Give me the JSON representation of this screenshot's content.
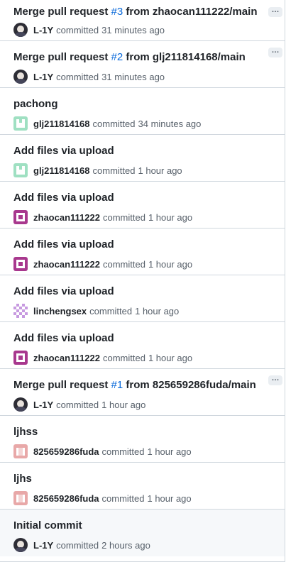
{
  "commits": [
    {
      "title_prefix": "Merge pull request ",
      "pr_link": "#3",
      "title_suffix": " from zhaocan111222/main",
      "author": "L-1Y",
      "verb": "committed",
      "time": "31 minutes ago",
      "avatar": "photo-avatar",
      "has_ellipsis": true
    },
    {
      "title_prefix": "Merge pull request ",
      "pr_link": "#2",
      "title_suffix": " from glj211814168/main",
      "author": "L-1Y",
      "verb": "committed",
      "time": "31 minutes ago",
      "avatar": "photo-avatar",
      "has_ellipsis": true
    },
    {
      "title_prefix": "pachong",
      "pr_link": "",
      "title_suffix": "",
      "author": "glj211814168",
      "verb": "committed",
      "time": "34 minutes ago",
      "avatar": "green-identicon"
    },
    {
      "title_prefix": "Add files via upload",
      "pr_link": "",
      "title_suffix": "",
      "author": "glj211814168",
      "verb": "committed",
      "time": "1 hour ago",
      "avatar": "green-identicon"
    },
    {
      "title_prefix": "Add files via upload",
      "pr_link": "",
      "title_suffix": "",
      "author": "zhaocan111222",
      "verb": "committed",
      "time": "1 hour ago",
      "avatar": "purple-identicon"
    },
    {
      "title_prefix": "Add files via upload",
      "pr_link": "",
      "title_suffix": "",
      "author": "zhaocan111222",
      "verb": "committed",
      "time": "1 hour ago",
      "avatar": "purple-identicon"
    },
    {
      "title_prefix": "Add files via upload",
      "pr_link": "",
      "title_suffix": "",
      "author": "linchengsex",
      "verb": "committed",
      "time": "1 hour ago",
      "avatar": "lilac-identicon"
    },
    {
      "title_prefix": "Add files via upload",
      "pr_link": "",
      "title_suffix": "",
      "author": "zhaocan111222",
      "verb": "committed",
      "time": "1 hour ago",
      "avatar": "purple-identicon"
    },
    {
      "title_prefix": "Merge pull request ",
      "pr_link": "#1",
      "title_suffix": " from 825659286fuda/main",
      "author": "L-1Y",
      "verb": "committed",
      "time": "1 hour ago",
      "avatar": "photo-avatar",
      "has_ellipsis": true
    },
    {
      "title_prefix": "ljhss",
      "pr_link": "",
      "title_suffix": "",
      "author": "825659286fuda",
      "verb": "committed",
      "time": "1 hour ago",
      "avatar": "salmon-identicon"
    },
    {
      "title_prefix": "ljhs",
      "pr_link": "",
      "title_suffix": "",
      "author": "825659286fuda",
      "verb": "committed",
      "time": "1 hour ago",
      "avatar": "salmon-identicon"
    },
    {
      "title_prefix": "Initial commit",
      "pr_link": "",
      "title_suffix": "",
      "author": "L-1Y",
      "verb": "committed",
      "time": "2 hours ago",
      "avatar": "photo-avatar"
    }
  ],
  "ellipsis_label": "…",
  "colors": {
    "link": "#0969da",
    "border": "#d0d7de",
    "muted": "#57606a"
  }
}
